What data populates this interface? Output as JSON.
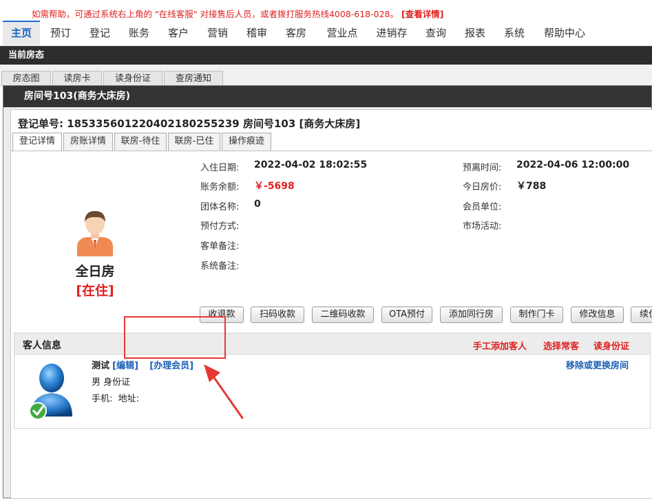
{
  "notice": {
    "text": "如需帮助，可通过系统右上角的 \"在线客服\" 对接售后人员，或者拨打服务热线4008-618-028。",
    "link": "[查看详情]"
  },
  "nav": [
    "主页",
    "预订",
    "登记",
    "账务",
    "客户",
    "营销",
    "稽审",
    "客房",
    "营业点",
    "进销存",
    "查询",
    "报表",
    "系统",
    "帮助中心"
  ],
  "section_bar": "当前房态",
  "subtabs": [
    "房态图",
    "读房卡",
    "读身份证",
    "查房通知"
  ],
  "dialog": {
    "title": "房间号103(商务大床房)",
    "reg_label": "登记单号:",
    "reg_number": "185335601220402180255239",
    "reg_room": "房间号103 [商务大床房]",
    "tabs": [
      "登记详情",
      "房账详情",
      "联房-待住",
      "联房-已住",
      "操作痕迹"
    ]
  },
  "room": {
    "type": "全日房",
    "status": "[在住]"
  },
  "info": {
    "checkin_label": "入住日期:",
    "checkin_value": "2022-04-02 18:02:55",
    "balance_label": "账务余额:",
    "balance_value": "￥-5698",
    "group_label": "团体名称:",
    "group_value": "0",
    "prepay_label": "预付方式:",
    "order_note_label": "客单备注:",
    "sys_note_label": "系统备注:",
    "checkout_label": "预离时间:",
    "checkout_value": "2022-04-06 12:00:00",
    "price_label": "今日房价:",
    "price_value": "￥788",
    "member_label": "会员单位:",
    "market_label": "市场活动:"
  },
  "actions": [
    "收退款",
    "扫码收款",
    "二维码收款",
    "OTA预付",
    "添加同行房",
    "制作门卡",
    "修改信息",
    "续住"
  ],
  "guest": {
    "section_title": "客人信息",
    "links": [
      "手工添加客人",
      "选择常客",
      "读身份证"
    ],
    "name": "测试",
    "edit_link": "[编辑]",
    "member_link": "[办理会员]",
    "gender_id": "男 身份证",
    "contact": "手机:  地址:",
    "room_action": "移除或更换房间"
  },
  "colors": {
    "accent_blue": "#1a5fb4",
    "alert_red": "#e02020",
    "dark_bar": "#2d2d2d",
    "annotation_red": "#e53935"
  },
  "icons": {
    "room_avatar": "person-icon",
    "guest_avatar": "user-checked-icon",
    "annotation": "arrow-annotation"
  }
}
